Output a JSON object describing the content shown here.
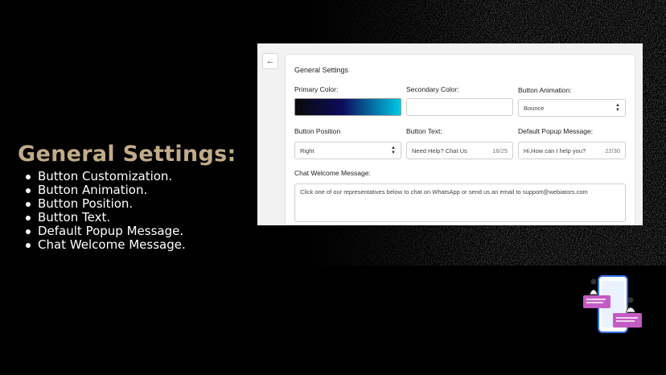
{
  "left": {
    "heading": "General Settings:",
    "features": [
      "Button Customization.",
      "Button Animation.",
      "Button Position.",
      "Button Text.",
      "Default Popup Message.",
      "Chat Welcome Message."
    ]
  },
  "settings": {
    "back_icon": "arrow-left-icon",
    "title": "General Settings",
    "primary_color_label": "Primary Color:",
    "secondary_color_label": "Secondary Color:",
    "button_animation_label": "Button Animation:",
    "button_animation_value": "Bounce",
    "button_position_label": "Button Position",
    "button_position_value": "Right",
    "button_text_label": "Button Text:",
    "button_text_value": "Need Help? Chat Us",
    "button_text_count": "18/25",
    "popup_label": "Default Popup Message:",
    "popup_value": "Hi,How can I help you?",
    "popup_count": "22/30",
    "welcome_label": "Chat Welcome Message:",
    "welcome_value": "Click one of our representatives below to chat on WhatsApp or send us an email to support@webiators.com"
  },
  "colors": {
    "heading": "#c2ab8a",
    "primary_gradient": [
      "#0a0a0a",
      "#0d0d5c",
      "#00c8e6"
    ]
  }
}
